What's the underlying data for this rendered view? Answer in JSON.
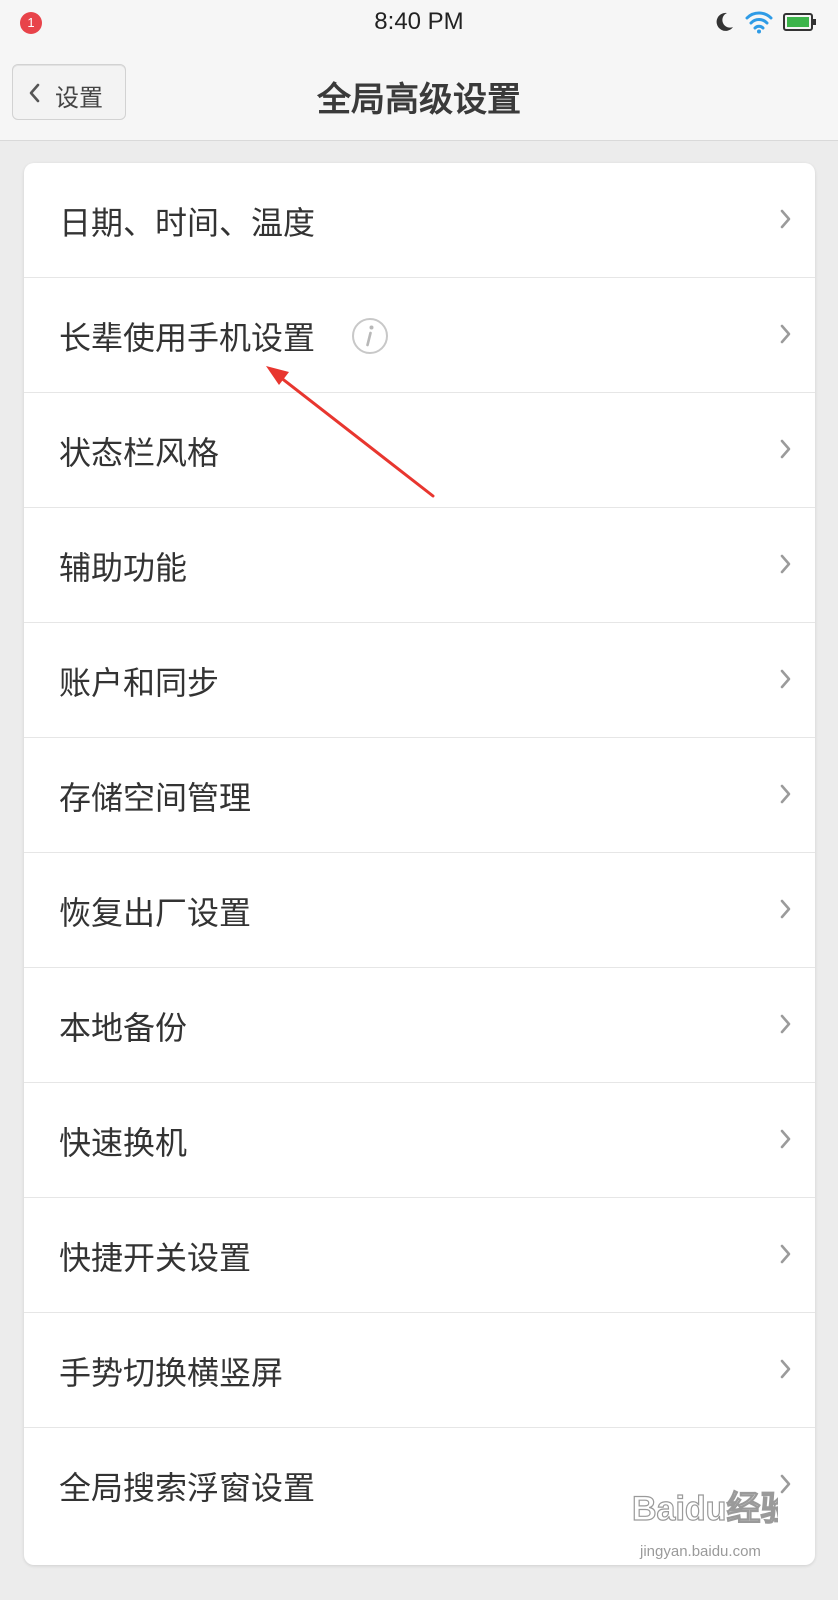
{
  "status_bar": {
    "notification_count": "1",
    "time": "8:40 PM"
  },
  "nav": {
    "back_label": "设置",
    "title": "全局高级设置"
  },
  "settings_items": [
    {
      "label": "日期、时间、温度"
    },
    {
      "label": "长辈使用手机设置"
    },
    {
      "label": "状态栏风格"
    },
    {
      "label": "辅助功能"
    },
    {
      "label": "账户和同步"
    },
    {
      "label": "存储空间管理"
    },
    {
      "label": "恢复出厂设置"
    },
    {
      "label": "本地备份"
    },
    {
      "label": "快速换机"
    },
    {
      "label": "快捷开关设置"
    },
    {
      "label": "手势切换横竖屏"
    },
    {
      "label": "全局搜索浮窗设置"
    }
  ],
  "watermark": {
    "brand": "Baidu经验",
    "url": "jingyan.baidu.com"
  },
  "colors": {
    "annotation_arrow": "#e8362f",
    "wifi": "#2e9be6",
    "battery": "#3cb44a",
    "notification_badge": "#e8434a"
  }
}
